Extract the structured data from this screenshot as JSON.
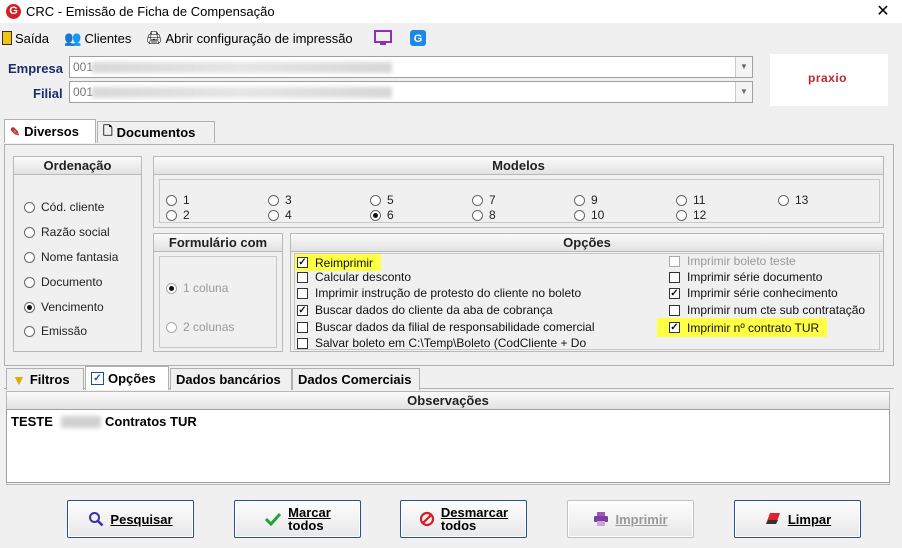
{
  "window": {
    "title": "CRC - Emissão de Ficha de Compensação",
    "logo_letter": "G"
  },
  "menu": {
    "saida": "Saída",
    "clientes": "Clientes",
    "config": "Abrir configuração de impressão"
  },
  "header": {
    "empresa_label": "Empresa",
    "empresa_value": "001",
    "filial_label": "Filial",
    "filial_value": "001",
    "brand": "praxio"
  },
  "top_tabs": {
    "diversos": "Diversos",
    "documentos": "Documentos"
  },
  "ordenacao": {
    "title": "Ordenação",
    "options": [
      "Cód. cliente",
      "Razão social",
      "Nome fantasia",
      "Documento",
      "Vencimento",
      "Emissão"
    ],
    "selected": "Vencimento"
  },
  "modelos": {
    "title": "Modelos",
    "options": [
      "1",
      "2",
      "3",
      "4",
      "5",
      "6",
      "7",
      "8",
      "9",
      "10",
      "11",
      "12",
      "13"
    ],
    "selected": "6"
  },
  "formulario": {
    "title": "Formulário com",
    "options": [
      "1 coluna",
      "2 colunas"
    ],
    "selected": "1 coluna"
  },
  "opcoes": {
    "title": "Opções",
    "left": [
      {
        "label": "Reimprimir",
        "checked": true,
        "highlight": true
      },
      {
        "label": "Calcular desconto",
        "checked": false
      },
      {
        "label": "Imprimir instrução de protesto do cliente no boleto",
        "checked": false
      },
      {
        "label": "Buscar dados do cliente da aba de cobrança",
        "checked": true
      },
      {
        "label": "Buscar dados da filial de responsabilidade comercial",
        "checked": false
      },
      {
        "label": "Salvar boleto em C:\\Temp\\Boleto (CodCliente + Do",
        "checked": false
      }
    ],
    "right": [
      {
        "label": "Imprimir boleto teste",
        "checked": false,
        "disabled": true
      },
      {
        "label": "Imprimir série documento",
        "checked": false
      },
      {
        "label": "Imprimir série conhecimento",
        "checked": true
      },
      {
        "label": "Imprimir num cte sub contratação",
        "checked": false
      },
      {
        "label": "Imprimir nº contrato TUR",
        "checked": true,
        "highlight": true
      }
    ]
  },
  "bottom_tabs": {
    "filtros": "Filtros",
    "opcoes": "Opções",
    "bancarios": "Dados bancários",
    "comerciais": "Dados Comerciais"
  },
  "observacoes": {
    "title": "Observações",
    "text_start": "TESTE",
    "text_end": "Contratos TUR"
  },
  "buttons": {
    "pesquisar": "Pesquisar",
    "marcar_1": "Marcar",
    "marcar_2": "todos",
    "desmarcar_1": "Desmarcar",
    "desmarcar_2": "todos",
    "imprimir": "Imprimir",
    "limpar": "Limpar"
  },
  "colors": {
    "accent": "#2b4f8f",
    "highlight": "#ffff44",
    "logo": "#d32027"
  }
}
